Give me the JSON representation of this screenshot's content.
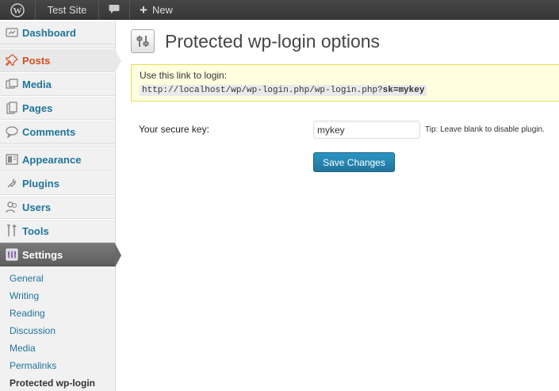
{
  "admin_bar": {
    "wp_logo_icon": "wordpress-logo-icon",
    "site_name": "Test Site",
    "comments_icon": "speech-bubble-icon",
    "new_label": "New",
    "new_icon": "plus-icon"
  },
  "sidebar": {
    "items": [
      {
        "label": "Dashboard",
        "icon": "dashboard-icon"
      },
      {
        "label": "Posts",
        "icon": "pushpin-icon"
      },
      {
        "label": "Media",
        "icon": "media-icon"
      },
      {
        "label": "Pages",
        "icon": "pages-icon"
      },
      {
        "label": "Comments",
        "icon": "comments-icon"
      },
      {
        "label": "Appearance",
        "icon": "appearance-icon"
      },
      {
        "label": "Plugins",
        "icon": "plugins-icon"
      },
      {
        "label": "Users",
        "icon": "users-icon"
      },
      {
        "label": "Tools",
        "icon": "tools-icon"
      },
      {
        "label": "Settings",
        "icon": "settings-icon"
      }
    ],
    "settings_submenu": [
      {
        "label": "General"
      },
      {
        "label": "Writing"
      },
      {
        "label": "Reading"
      },
      {
        "label": "Discussion"
      },
      {
        "label": "Media"
      },
      {
        "label": "Permalinks"
      },
      {
        "label": "Protected wp-login"
      }
    ]
  },
  "main": {
    "title": "Protected wp-login options",
    "title_icon": "settings-sliders-icon",
    "notice": {
      "text": "Use this link to login:",
      "url_prefix": "http://localhost/wp/wp-login.php/wp-login.php?",
      "url_param": "sk=mykey"
    },
    "form": {
      "label": "Your secure key:",
      "value": "mykey",
      "tip": "Tip: Leave blank to disable plugin."
    },
    "save_label": "Save Changes"
  },
  "colors": {
    "admin_bar_bg": "#464646",
    "link": "#21759b",
    "active_menu": "#d54e21",
    "notice_bg": "#ffffe0",
    "notice_border": "#e6db55",
    "button": "#21759b"
  }
}
